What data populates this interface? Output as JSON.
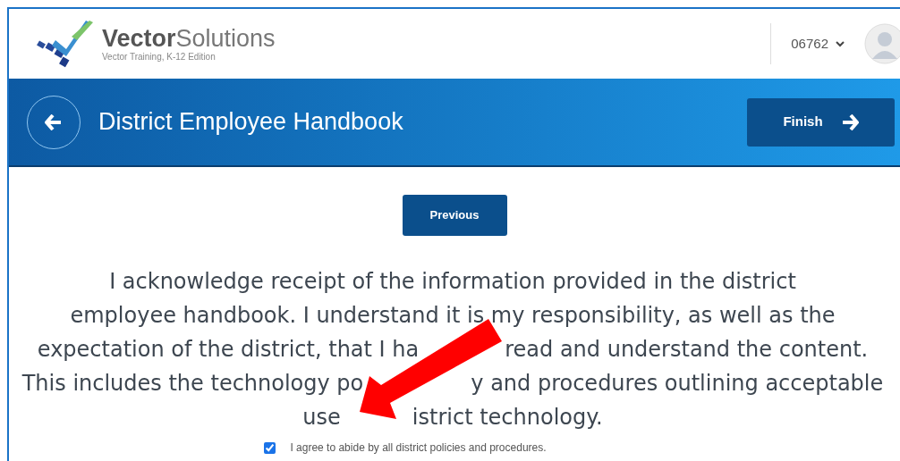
{
  "header": {
    "logo_title_bold": "Vector",
    "logo_title_light": "Solutions",
    "logo_subtitle": "Vector Training, K-12 Edition",
    "account": "06762"
  },
  "banner": {
    "title": "District Employee Handbook",
    "finish_button": "Finish"
  },
  "content": {
    "previous_button": "Previous",
    "acknowledgement_lines": [
      [
        "I acknowledge receipt of the information provided in the district"
      ],
      [
        "employee handbook. I understand it is my responsibility, as well as the"
      ],
      [
        "expectation of the district, that I ha",
        "read and understand the content."
      ],
      [
        "This includes the technology po",
        "y and procedures outlining acceptable"
      ],
      [
        "use",
        "istrict technology."
      ]
    ],
    "agree": {
      "label": "I agree to abide by all district policies and procedures.",
      "checked": true
    }
  }
}
